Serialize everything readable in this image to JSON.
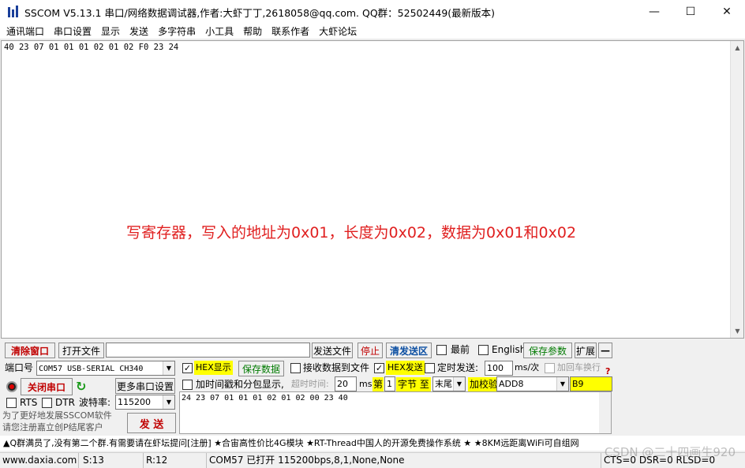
{
  "title": "SSCOM V5.13.1 串口/网络数据调试器,作者:大虾丁丁,2618058@qq.com. QQ群：52502449(最新版本)",
  "window_controls": {
    "minimize": "—",
    "maximize": "☐",
    "close": "✕"
  },
  "menu": [
    "通讯端口",
    "串口设置",
    "显示",
    "发送",
    "多字符串",
    "小工具",
    "帮助",
    "联系作者",
    "大虾论坛"
  ],
  "receive": {
    "content": "40 23 07 01 01 01 02 01 02 F0 23 24",
    "annotation": "写寄存器，写入的地址为0x01，长度为0x02，数据为0x01和0x02"
  },
  "toolbar": {
    "clear_window": "清除窗口",
    "open_file": "打开文件",
    "file_path": "",
    "send_file": "发送文件",
    "stop": "停止",
    "clear_send": "清发送区",
    "topmost": "最前",
    "english": "English",
    "save_params": "保存参数",
    "expand": "扩展",
    "collapse": "—"
  },
  "port": {
    "port_label": "端口号",
    "port_value": "COM57 USB-SERIAL CH340",
    "close_port": "关闭串口",
    "more_settings": "更多串口设置",
    "rts": "RTS",
    "dtr": "DTR",
    "baud_label": "波特率:",
    "baud_value": "115200",
    "promo_line1": "为了更好地发展SSCOM软件",
    "promo_line2": "请您注册嘉立创P结尾客户",
    "send_button": "发  送"
  },
  "options": {
    "hex_display": "HEX显示",
    "save_data": "保存数据",
    "recv_to_file": "接收数据到文件",
    "hex_send": "HEX发送",
    "timed_send": "定时发送:",
    "timed_interval": "100",
    "timed_unit": "ms/次",
    "add_newline": "加回车换行",
    "timestamp": "加时间戳和分包显示,",
    "timeout_label": "超时时间:",
    "timeout_value": "20",
    "timeout_unit": "ms",
    "byte_prefix": "第",
    "byte_index": "1",
    "byte_to": "字节 至",
    "byte_end": "末尾",
    "checksum_label": "加校验",
    "checksum_value": "ADD8",
    "checksum_result": "B9",
    "help_mark": "?"
  },
  "send": {
    "content": "24 23 07 01 01 01 02 01 02 00 23 40"
  },
  "ticker": "▲Q群满员了,没有第二个群.有需要请在虾坛提问[注册] ★合宙高性价比4G模块 ★RT-Thread中国人的开源免费操作系统 ★ ★8KM远距离WiFi可自组网",
  "status": {
    "website": "www.daxia.com",
    "sent": "S:13",
    "received": "R:12",
    "port_info": "COM57 已打开  115200bps,8,1,None,None",
    "signals": "CTS=0 DSR=0 RLSD=0"
  },
  "watermark": "CSDN @二十四画生920",
  "colors": {
    "accent_red": "#c00000",
    "annotation_red": "#e02020",
    "highlight_yellow": "#ffff00",
    "green": "#007a00"
  }
}
